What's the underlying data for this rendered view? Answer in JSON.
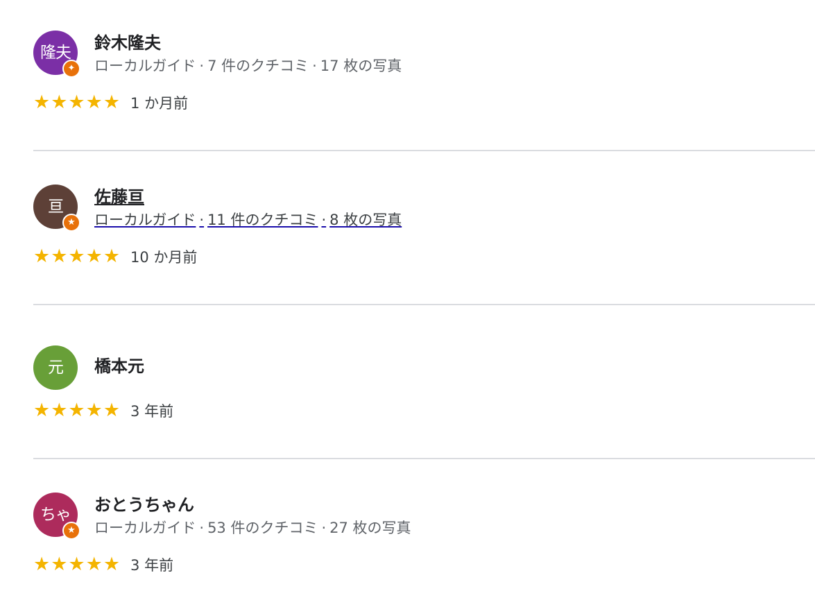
{
  "reviews": [
    {
      "initials": "隆夫",
      "avatar_color": "#7b2fa6",
      "local_guide_badge": true,
      "name": "鈴木隆夫",
      "meta": {
        "guide": "ローカルガイド",
        "sep1": "·",
        "reviews": "7 件のクチコミ",
        "sep2": "·",
        "photos": "17 枚の写真"
      },
      "stars": "★★★★★",
      "rating": 5,
      "time": "1 か月前"
    },
    {
      "initials": "亘",
      "avatar_color": "#5d4037",
      "local_guide_badge": true,
      "name": "佐藤亘",
      "meta": {
        "guide": "ローカルガイド",
        "sep1": "·",
        "reviews": "11 件のクチコミ",
        "sep2": "·",
        "photos": "8 枚の写真"
      },
      "stars": "★★★★★",
      "rating": 5,
      "time": "10 か月前"
    },
    {
      "initials": "元",
      "avatar_color": "#689f38",
      "local_guide_badge": false,
      "name": "橋本元",
      "stars": "★★★★★",
      "rating": 5,
      "time": "3 年前"
    },
    {
      "initials": "ちゃ",
      "avatar_color": "#ad2b5c",
      "local_guide_badge": true,
      "name": "おとうちゃん",
      "meta": {
        "guide": "ローカルガイド",
        "sep1": "·",
        "reviews": "53 件のクチコミ",
        "sep2": "·",
        "photos": "27 枚の写真"
      },
      "stars": "★★★★★",
      "rating": 5,
      "time": "3 年前"
    }
  ],
  "badge_icon": "local-guide-star-icon",
  "star_color": "#f4b400",
  "badge_color": "#e8710a"
}
